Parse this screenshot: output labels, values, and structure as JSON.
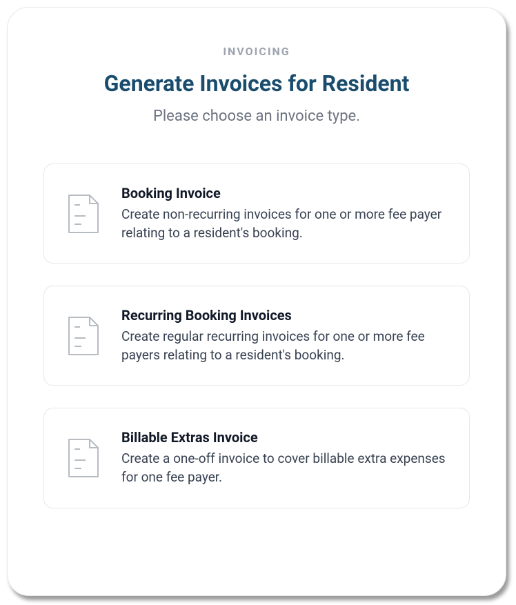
{
  "header": {
    "eyebrow": "INVOICING",
    "title": "Generate Invoices for Resident",
    "subtitle": "Please choose an invoice type."
  },
  "options": [
    {
      "id": "booking-invoice",
      "title": "Booking Invoice",
      "description": "Create non-recurring invoices for one or more fee payer relating to a resident's booking."
    },
    {
      "id": "recurring-booking-invoices",
      "title": "Recurring Booking Invoices",
      "description": "Create regular recurring invoices for one or more fee payers relating to a resident's booking."
    },
    {
      "id": "billable-extras-invoice",
      "title": "Billable Extras Invoice",
      "description": "Create a one-off invoice to cover billable extra expenses for one fee payer."
    }
  ]
}
